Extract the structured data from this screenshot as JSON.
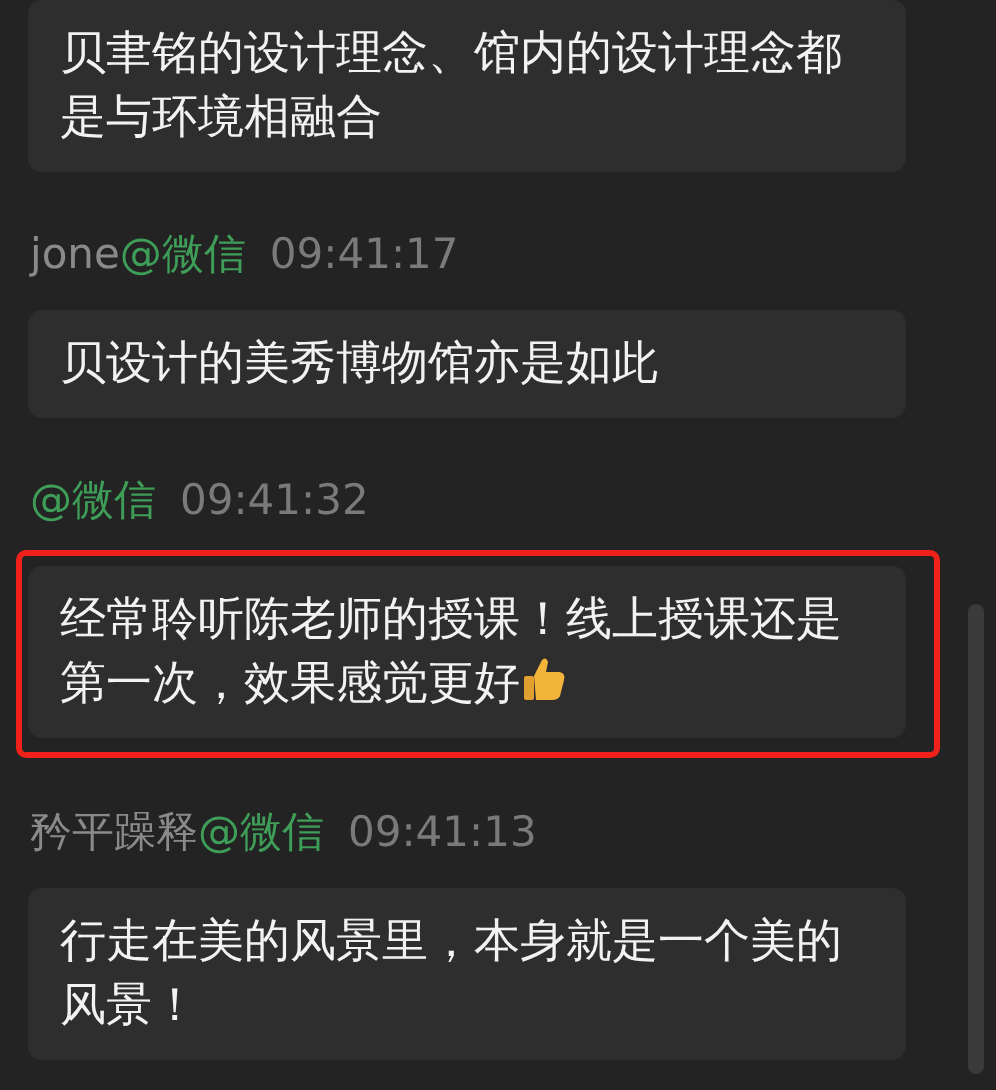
{
  "messages": [
    {
      "text": "贝聿铭的设计理念、馆内的设计理念都是与环境相融合",
      "highlighted": false
    },
    {
      "sender": {
        "name": "jone",
        "platform": "@微信",
        "time": "09:41:17"
      },
      "text": "贝设计的美秀博物馆亦是如此",
      "highlighted": false
    },
    {
      "sender": {
        "platform": "@微信",
        "time": "09:41:32"
      },
      "text": "经常聆听陈老师的授课！线上授课还是第一次，效果感觉更好",
      "thumbs_up": true,
      "highlighted": true
    },
    {
      "sender": {
        "name": "矜平躁释",
        "platform": "@微信",
        "time": "09:41:13"
      },
      "text": "行走在美的风景里，本身就是一个美的风景！",
      "highlighted": false
    }
  ]
}
